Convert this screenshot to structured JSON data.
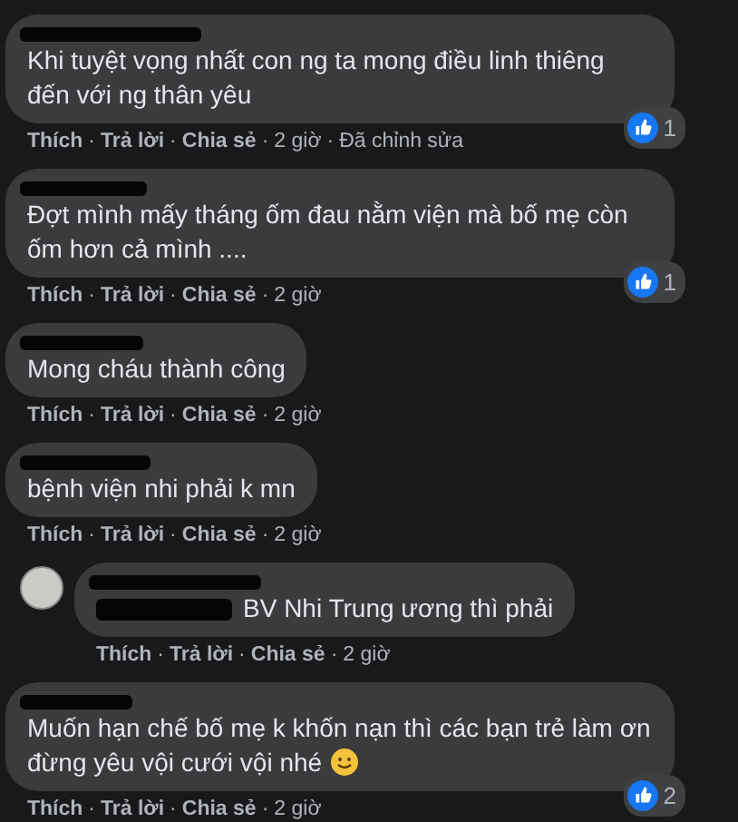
{
  "separator": "·",
  "comments": [
    {
      "kind": "comment",
      "text": "Khi tuyệt vọng nhất con ng ta mong điều linh thiêng đến với ng thân yêu",
      "emoji": false,
      "actions": [
        "Thích",
        "Trả lời",
        "Chia sẻ"
      ],
      "time": "2 giờ",
      "edited": "Đã chỉnh sửa",
      "likes": "1"
    },
    {
      "kind": "comment",
      "text": "Đợt mình mấy tháng ốm đau nằm viện mà bố mẹ còn ốm hơn cả mình ....",
      "emoji": false,
      "actions": [
        "Thích",
        "Trả lời",
        "Chia sẻ"
      ],
      "time": "2 giờ",
      "likes": "1"
    },
    {
      "kind": "comment",
      "text": "Mong cháu thành công",
      "emoji": false,
      "actions": [
        "Thích",
        "Trả lời",
        "Chia sẻ"
      ],
      "time": "2 giờ"
    },
    {
      "kind": "comment",
      "text": "bệnh viện nhi phải k mn",
      "emoji": false,
      "actions": [
        "Thích",
        "Trả lời",
        "Chia sẻ"
      ],
      "time": "2 giờ"
    },
    {
      "kind": "reply",
      "text": "BV Nhi Trung ương thì phải",
      "emoji": false,
      "actions": [
        "Thích",
        "Trả lời",
        "Chia sẻ"
      ],
      "time": "2 giờ"
    },
    {
      "kind": "comment",
      "text": "Muốn hạn chế bố mẹ k khốn nạn thì các bạn trẻ làm ơn đừng yêu vội cưới vội nhé",
      "emoji": true,
      "actions": [
        "Thích",
        "Trả lời",
        "Chia sẻ"
      ],
      "time": "2 giờ",
      "likes": "2"
    }
  ]
}
